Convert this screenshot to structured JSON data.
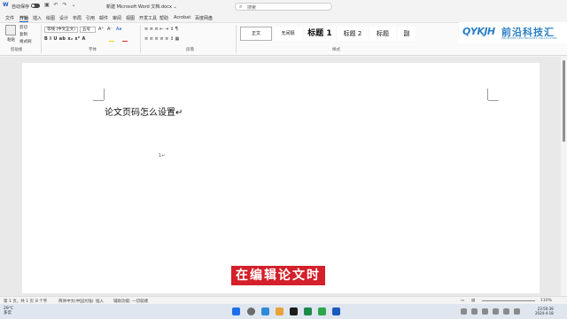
{
  "titlebar": {
    "autosave": "自动保存",
    "doc_name": "新建 Microsoft Word 文档.docx ⌄",
    "search_placeholder": "搜索"
  },
  "menu": {
    "tabs": [
      "文件",
      "开始",
      "插入",
      "绘图",
      "设计",
      "布局",
      "引用",
      "邮件",
      "审阅",
      "视图",
      "开发工具",
      "帮助",
      "Acrobat",
      "百度网盘"
    ]
  },
  "ribbon": {
    "paste_label": "粘贴",
    "cut_label": "剪切",
    "copy_label": "复制",
    "format_painter_label": "格式刷",
    "font_name": "等线 (中文正文)",
    "font_size": "五号",
    "font_size_grow": "A⁺",
    "font_size_shrink": "A⁻",
    "format_buttons": "B  I  U  ab  x₂  x²  A",
    "para_row1": "≡  ≡  ≡  ⇤  ⇥  ↕  ¶",
    "para_row2": "≡  ≡  ≡  ≡  ≡  ↕  ▦",
    "group_clipboard": "剪贴板",
    "group_font": "字体",
    "group_paragraph": "段落",
    "group_styles": "样式",
    "styles": [
      "正文",
      "无间隔",
      "标题 1",
      "标题 2",
      "标题",
      "副"
    ]
  },
  "logo": {
    "mark": "QYKJH",
    "name": "前沿科技汇",
    "sub": "FRONTIER TECHNOLOGY COLLECTION"
  },
  "document": {
    "heading": "论文页码怎么设置↵",
    "cursor_mark": "1↵"
  },
  "subtitle": "在编辑论文时",
  "statusbar": {
    "page": "第 1 页，共 1 页",
    "words": "8 个字",
    "language": "简体中文(中国大陆)",
    "insert": "插入",
    "accessibility": "辅助功能: 一切就绪",
    "zoom": "110%"
  },
  "taskbar": {
    "weather_temp": "29°C",
    "weather_desc": "多云",
    "time": "23:50:39",
    "date": "2024-4-18"
  }
}
